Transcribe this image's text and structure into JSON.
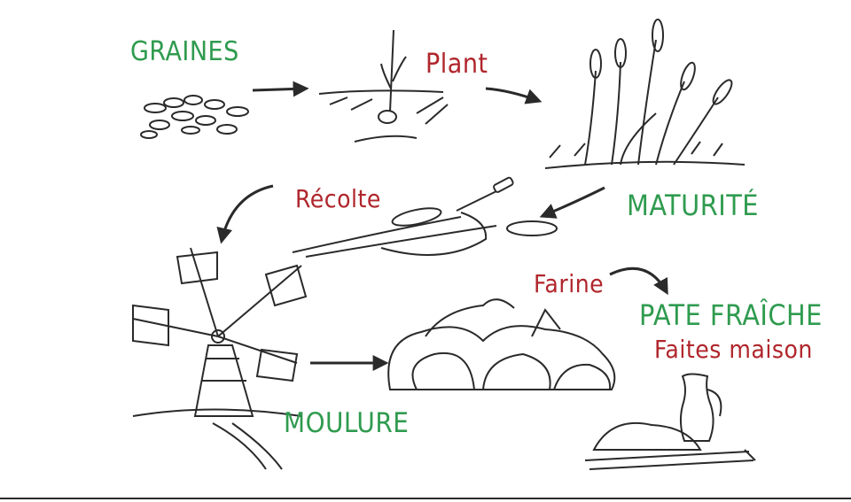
{
  "labels": {
    "graines": "GRAINES",
    "plant": "Plant",
    "recolte": "Récolte",
    "maturite": "MATURITÉ",
    "farine": "Farine",
    "pate": "PATE FRAÎCHE",
    "faites": "Faites maison",
    "moulure": "MOULURE"
  },
  "colors": {
    "stage_green": "#2f9b4f",
    "note_red": "#b0262c",
    "ink": "#2a2a2a"
  },
  "icons": [
    "seeds-icon",
    "sprout-icon",
    "wheat-field-icon",
    "harvest-sickle-icon",
    "windmill-icon",
    "flour-sacks-icon",
    "jug-dough-icon"
  ]
}
